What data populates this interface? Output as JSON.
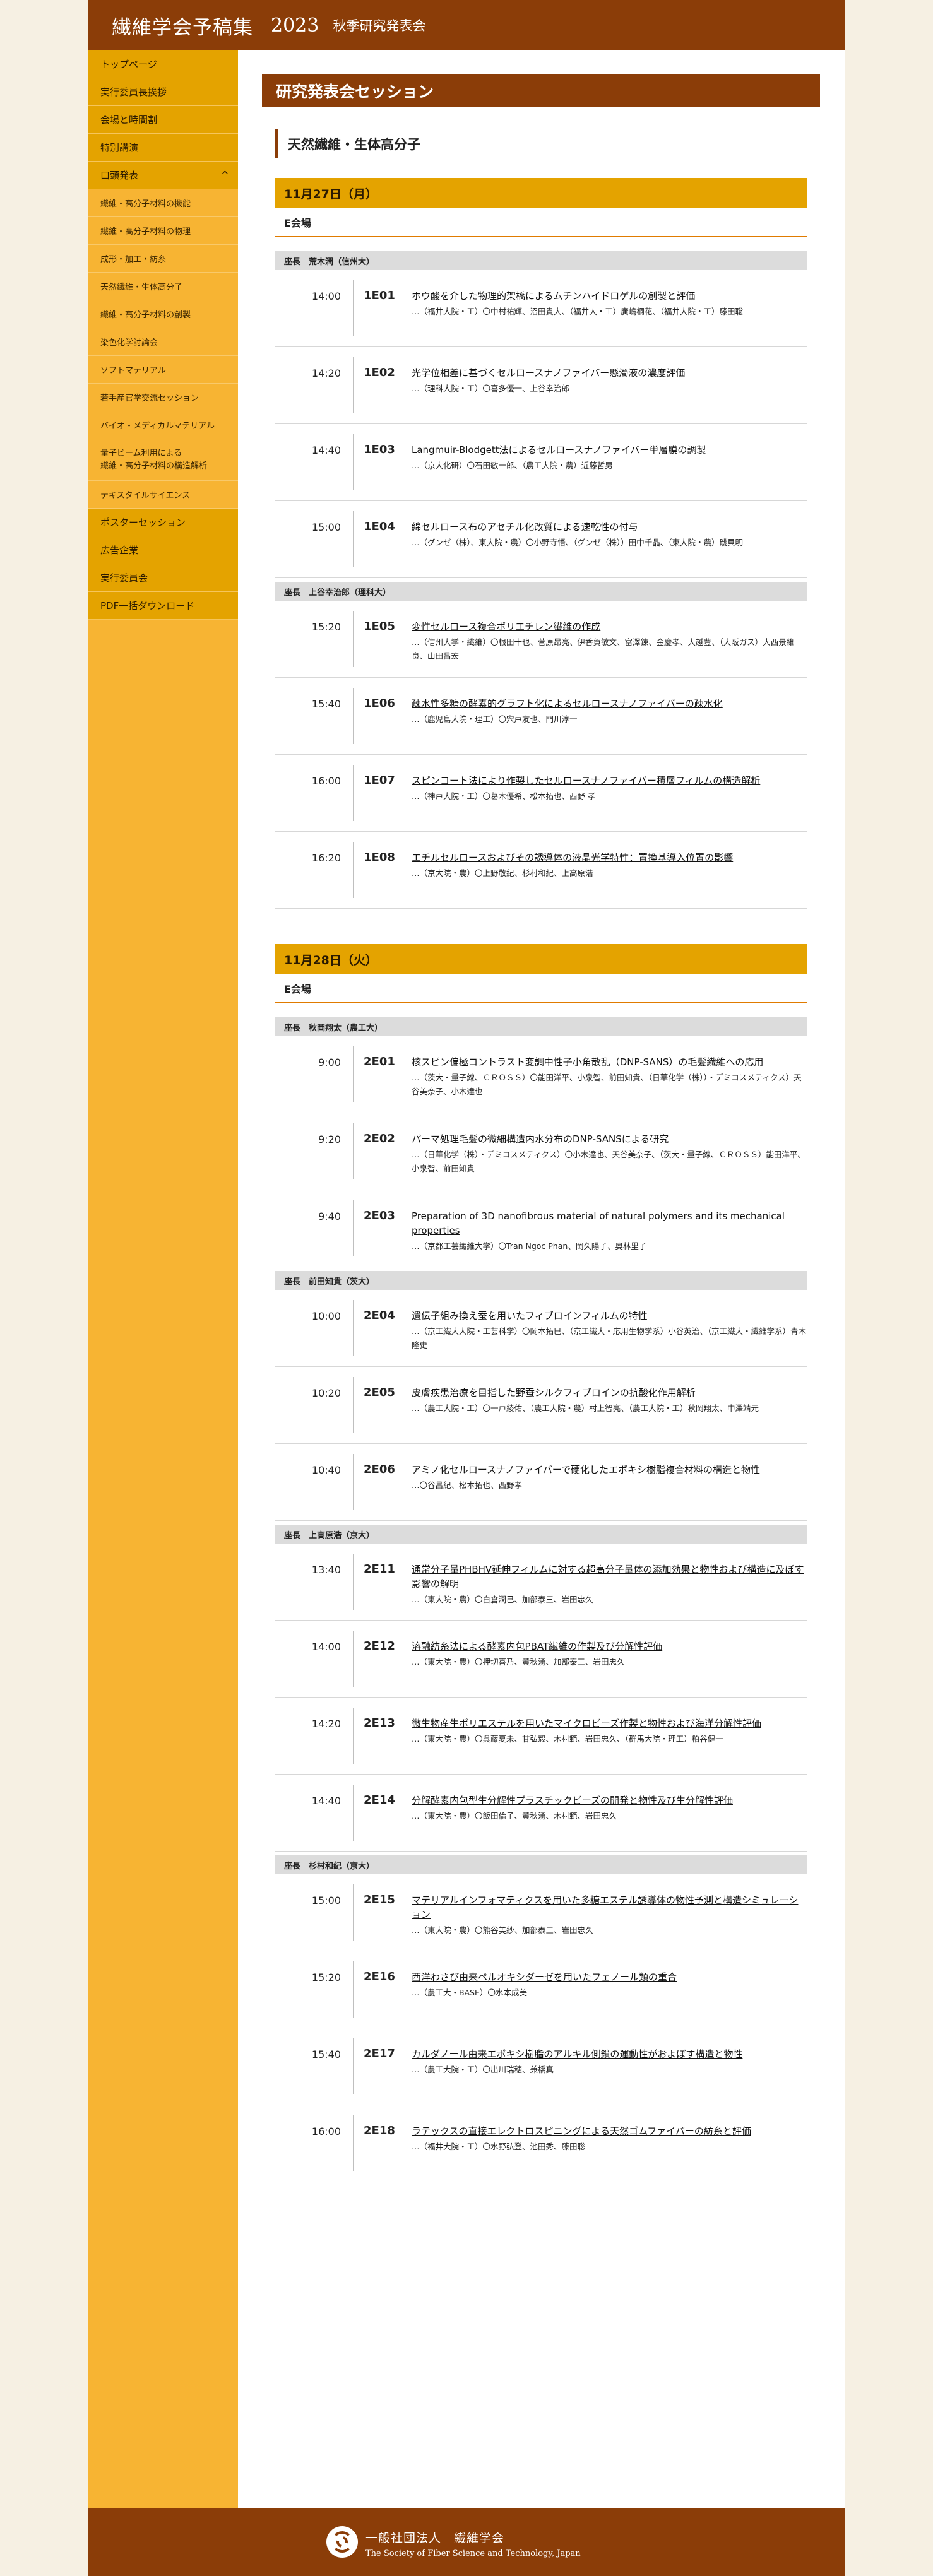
{
  "header": {
    "title": "繊維学会予稿集",
    "year": "2023",
    "event": "秋季研究発表会"
  },
  "sidebar": {
    "items": [
      {
        "label": "トップページ",
        "sub": false
      },
      {
        "label": "実行委員長挨拶",
        "sub": false
      },
      {
        "label": "会場と時間割",
        "sub": false
      },
      {
        "label": "特別講演",
        "sub": false
      },
      {
        "label": "口頭発表",
        "sub": false,
        "toggle": "^"
      },
      {
        "label": "繊維・高分子材料の機能",
        "sub": true
      },
      {
        "label": "繊維・高分子材料の物理",
        "sub": true
      },
      {
        "label": "成形・加工・紡糸",
        "sub": true
      },
      {
        "label": "天然繊維・生体高分子",
        "sub": true
      },
      {
        "label": "繊維・高分子材料の創製",
        "sub": true
      },
      {
        "label": "染色化学討論会",
        "sub": true
      },
      {
        "label": "ソフトマテリアル",
        "sub": true
      },
      {
        "label": "若手産官学交流セッション",
        "sub": true
      },
      {
        "label": "バイオ・メディカルマテリアル",
        "sub": true
      },
      {
        "label": "量子ビーム利用による\n繊維・高分子材料の構造解析",
        "sub": true,
        "tall": true
      },
      {
        "label": "テキスタイルサイエンス",
        "sub": true
      },
      {
        "label": "ポスターセッション",
        "sub": false
      },
      {
        "label": "広告企業",
        "sub": false
      },
      {
        "label": "実行委員会",
        "sub": false
      },
      {
        "label": "PDF一括ダウンロード",
        "sub": false
      }
    ]
  },
  "main": {
    "section_title": "研究発表会セッション",
    "session_name": "天然繊維・生体高分子",
    "days": [
      {
        "date": "11月27日（月）",
        "room": "E会場",
        "groups": [
          {
            "chair": "座長　荒木潤（信州大）",
            "talks": [
              {
                "time": "14:00",
                "code": "1E01",
                "title": "ホウ酸を介した物理的架橋によるムチンハイドロゲルの創製と評価",
                "authors": "…（福井大院・工）〇中村祐輝、沼田貴大、（福井大・工）廣嶋桐花、（福井大院・工）藤田聡"
              },
              {
                "time": "14:20",
                "code": "1E02",
                "title": "光学位相差に基づくセルロースナノファイバー懸濁液の濃度評価",
                "authors": "…（理科大院・工）〇喜多優一、上谷幸治郎"
              },
              {
                "time": "14:40",
                "code": "1E03",
                "title": "Langmuir-Blodgett法によるセルロースナノファイバー単層膜の調製",
                "authors": "…（京大化研）〇石田敏一郎、（農工大院・農）近藤哲男"
              },
              {
                "time": "15:00",
                "code": "1E04",
                "title": "綿セルロース布のアセチル化改質による速乾性の付与",
                "authors": "…（グンゼ（株）、東大院・農）〇小野寺悟、（グンゼ（株））田中千晶、（東大院・農）磯貝明"
              }
            ]
          },
          {
            "chair": "座長　上谷幸治郎（理科大）",
            "talks": [
              {
                "time": "15:20",
                "code": "1E05",
                "title": "変性セルロース複合ポリエチレン繊維の作成",
                "authors": "…（信州大学・繊維）〇根田十也、菅原昂亮、伊香賀敏文、富澤錬、金慶孝、大越豊、（大阪ガス）大西景維良、山田昌宏"
              },
              {
                "time": "15:40",
                "code": "1E06",
                "title": "疎水性多糖の酵素的グラフト化によるセルロースナノファイバーの疎水化",
                "authors": "…（鹿児島大院・理工）〇宍戸友也、門川淳一"
              },
              {
                "time": "16:00",
                "code": "1E07",
                "title": "スピンコート法により作製したセルロースナノファイバー積層フィルムの構造解析",
                "authors": "…（神戸大院・工）〇葛木優希、松本拓也、西野 孝"
              },
              {
                "time": "16:20",
                "code": "1E08",
                "title": "エチルセルロースおよびその誘導体の液晶光学特性：置換基導入位置の影響",
                "authors": "…（京大院・農）〇上野敬紀、杉村和紀、上高原浩"
              }
            ]
          }
        ]
      },
      {
        "date": "11月28日（火）",
        "room": "E会場",
        "groups": [
          {
            "chair": "座長　秋岡翔太（農工大）",
            "talks": [
              {
                "time": "9:00",
                "code": "2E01",
                "title": "核スピン偏極コントラスト変調中性子小角散乱（DNP-SANS）の毛髪繊維への応用",
                "authors": "…（茨大・量子線、ＣＲＯＳＳ）〇能田洋平、小泉智、前田知貴、（日華化学（株））・デミコスメティクス）天谷美奈子、小木達也"
              },
              {
                "time": "9:20",
                "code": "2E02",
                "title": "パーマ処理毛髪の微細構造内水分布のDNP-SANSによる研究",
                "authors": "…（日華化学（株）・デミコスメティクス）〇小木達也、天谷美奈子、（茨大・量子線、ＣＲＯＳＳ）能田洋平、小泉智、前田知貴"
              },
              {
                "time": "9:40",
                "code": "2E03",
                "title": "Preparation of 3D nanofibrous material of natural polymers and its mechanical properties",
                "authors": "…（京都工芸繊維大学）〇Tran Ngoc Phan、岡久陽子、奥林里子"
              }
            ]
          },
          {
            "chair": "座長　前田知貴（茨大）",
            "talks": [
              {
                "time": "10:00",
                "code": "2E04",
                "title": "遺伝子組み換え蚕を用いたフィブロインフィルムの特性",
                "authors": "…（京工繊大大院・工芸科学）〇岡本拓巳、（京工繊大・応用生物学系）小谷英治、（京工繊大・繊維学系）青木隆史"
              },
              {
                "time": "10:20",
                "code": "2E05",
                "title": "皮膚疾患治療を目指した野蚕シルクフィブロインの抗酸化作用解析",
                "authors": "…（農工大院・工）〇一戸綾佑、（農工大院・農）村上智亮、（農工大院・工）秋岡翔太、中澤靖元"
              },
              {
                "time": "10:40",
                "code": "2E06",
                "title": "アミノ化セルロースナノファイバーで硬化したエポキシ樹脂複合材料の構造と物性",
                "authors": "…〇谷昌紀、松本拓也、西野孝"
              }
            ]
          },
          {
            "chair": "座長　上高原浩（京大）",
            "talks": [
              {
                "time": "13:40",
                "code": "2E11",
                "title": "通常分子量PHBHV延伸フィルムに対する超高分子量体の添加効果と物性および構造に及ぼす影響の解明",
                "authors": "…（東大院・農）〇白倉潤己、加部泰三、岩田忠久"
              },
              {
                "time": "14:00",
                "code": "2E12",
                "title": "溶融紡糸法による酵素内包PBAT繊維の作製及び分解性評価",
                "authors": "…（東大院・農）〇押切喜乃、黄秋湧、加部泰三、岩田忠久"
              },
              {
                "time": "14:20",
                "code": "2E13",
                "title": "微生物産生ポリエステルを用いたマイクロビーズ作製と物性および海洋分解性評価",
                "authors": "…（東大院・農）〇呉藤夏未、甘弘毅、木村範、岩田忠久、（群馬大院・理工）粕谷健一"
              },
              {
                "time": "14:40",
                "code": "2E14",
                "title": "分解酵素内包型生分解性プラスチックビーズの開発と物性及び生分解性評価",
                "authors": "…（東大院・農）〇飯田倫子、黄秋湧、木村範、岩田忠久"
              }
            ]
          },
          {
            "chair": "座長　杉村和紀（京大）",
            "talks": [
              {
                "time": "15:00",
                "code": "2E15",
                "title": "マテリアルインフォマティクスを用いた多糖エステル誘導体の物性予測と構造シミュレーション",
                "authors": "…（東大院・農）〇熊谷美紗、加部泰三、岩田忠久"
              },
              {
                "time": "15:20",
                "code": "2E16",
                "title": "西洋わさび由来ペルオキシダーゼを用いたフェノール類の重合",
                "authors": "…（農工大・BASE）〇水本成美"
              },
              {
                "time": "15:40",
                "code": "2E17",
                "title": "カルダノール由来エポキシ樹脂のアルキル側鎖の運動性がおよぼす構造と物性",
                "authors": "…（農工大院・工）〇出川瑞穂、兼橋真二"
              },
              {
                "time": "16:00",
                "code": "2E18",
                "title": "ラテックスの直接エレクトロスピニングによる天然ゴムファイバーの紡糸と評価",
                "authors": "…（福井大院・工）〇水野弘登、池田秀、藤田聡"
              }
            ]
          }
        ]
      }
    ]
  },
  "footer": {
    "org_jp": "一般社団法人　繊維学会",
    "org_en": "The Society of Fiber Science and Technology, Japan"
  },
  "colors": {
    "brand": "#8b3d08",
    "accent": "#e4a300",
    "sidebar": "#f7b433"
  }
}
